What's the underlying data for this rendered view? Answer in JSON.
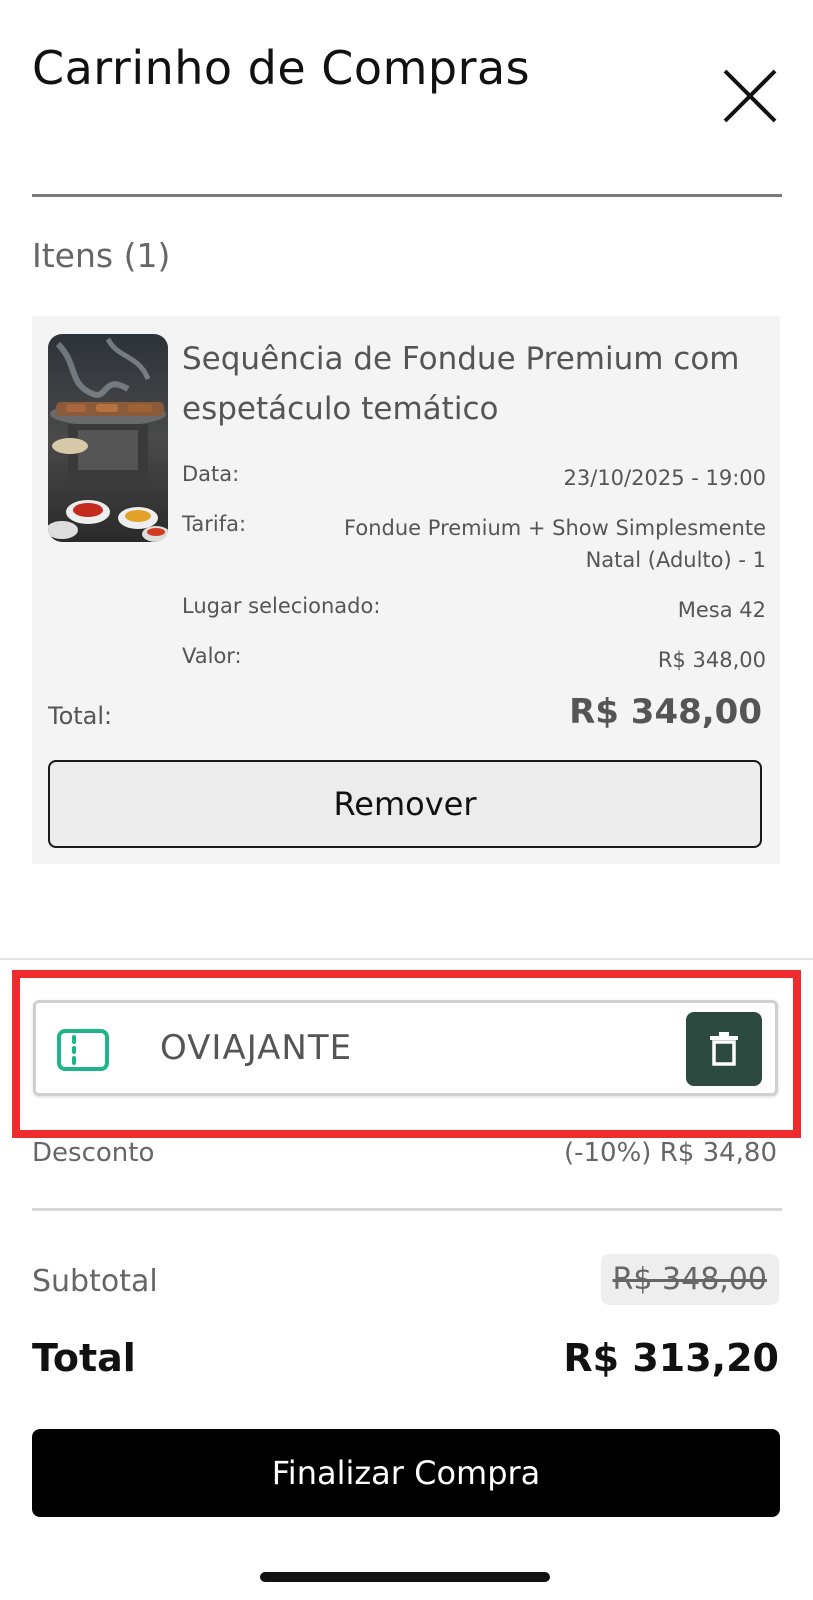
{
  "header": {
    "title": "Carrinho de Compras"
  },
  "items_label": "Itens (1)",
  "cart_item": {
    "name": "Sequência de Fondue Premium com espetáculo temático",
    "data_label": "Data:",
    "data_value": "23/10/2025 - 19:00",
    "tarifa_label": "Tarifa:",
    "tarifa_value": "Fondue Premium + Show Simplesmente Natal (Adulto) - 1",
    "lugar_label": "Lugar selecionado:",
    "lugar_value": "Mesa 42",
    "valor_label": "Valor:",
    "valor_value": "R$ 348,00",
    "total_label": "Total:",
    "total_value": "R$ 348,00",
    "remove_label": "Remover"
  },
  "coupon": {
    "code": "OVIAJANTE"
  },
  "summary": {
    "desconto_label": "Desconto",
    "desconto_value": "(-10%) R$ 34,80",
    "subtotal_label": "Subtotal",
    "subtotal_value": "R$ 348,00",
    "total_label": "Total",
    "total_value": "R$ 313,20"
  },
  "checkout_label": "Finalizar Compra",
  "colors": {
    "accent_dark_green": "#2c4a40",
    "coupon_icon": "#1fb58a",
    "highlight_red": "#ef2b2d"
  }
}
